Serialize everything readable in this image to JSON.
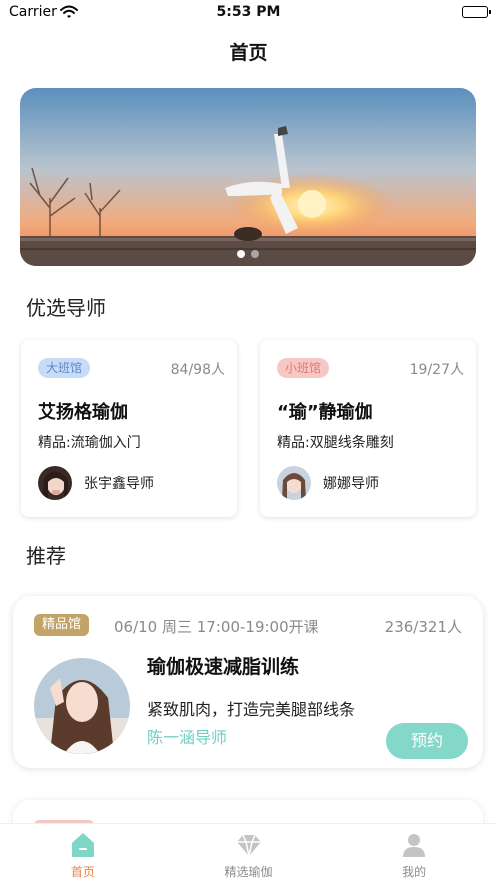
{
  "status_bar": {
    "carrier": "Carrier",
    "time": "5:53 PM",
    "icons": [
      "wifi-icon",
      "battery-icon"
    ]
  },
  "nav": {
    "title": "首页"
  },
  "banner": {
    "image": "yoga-sunset-photo",
    "dot_count": 2,
    "active_dot": 0
  },
  "sections": {
    "teachers_title": "优选导师",
    "recommend_title": "推荐"
  },
  "teacher_cards": [
    {
      "tag": "大班馆",
      "tag_color": "#c8dcf7",
      "count": "84/98人",
      "course": "艾扬格瑜伽",
      "subtitle": "精品:流瑜伽入门",
      "teacher": "张宇鑫导师"
    },
    {
      "tag": "小班馆",
      "tag_color": "#f6c7c4",
      "count": "19/27人",
      "course": "“瑜”静瑜伽",
      "subtitle": "精品:双腿线条雕刻",
      "teacher": "娜娜导师"
    }
  ],
  "recommend": {
    "tag": "精品馆",
    "time": "06/10 周三 17:00-19:00开课",
    "count": "236/321人",
    "title": "瑜伽极速减脂训练",
    "description": "紧致肌肉，打造完美腿部线条",
    "teacher": "陈一涵导师",
    "button": "预约",
    "accent_color": "#84d8c9"
  },
  "tab_bar": {
    "items": [
      {
        "label": "首页",
        "icon": "home-icon",
        "active": true
      },
      {
        "label": "精选瑜伽",
        "icon": "diamond-icon",
        "active": false
      },
      {
        "label": "我的",
        "icon": "user-icon",
        "active": false
      }
    ],
    "active_color": "#e8834f"
  }
}
